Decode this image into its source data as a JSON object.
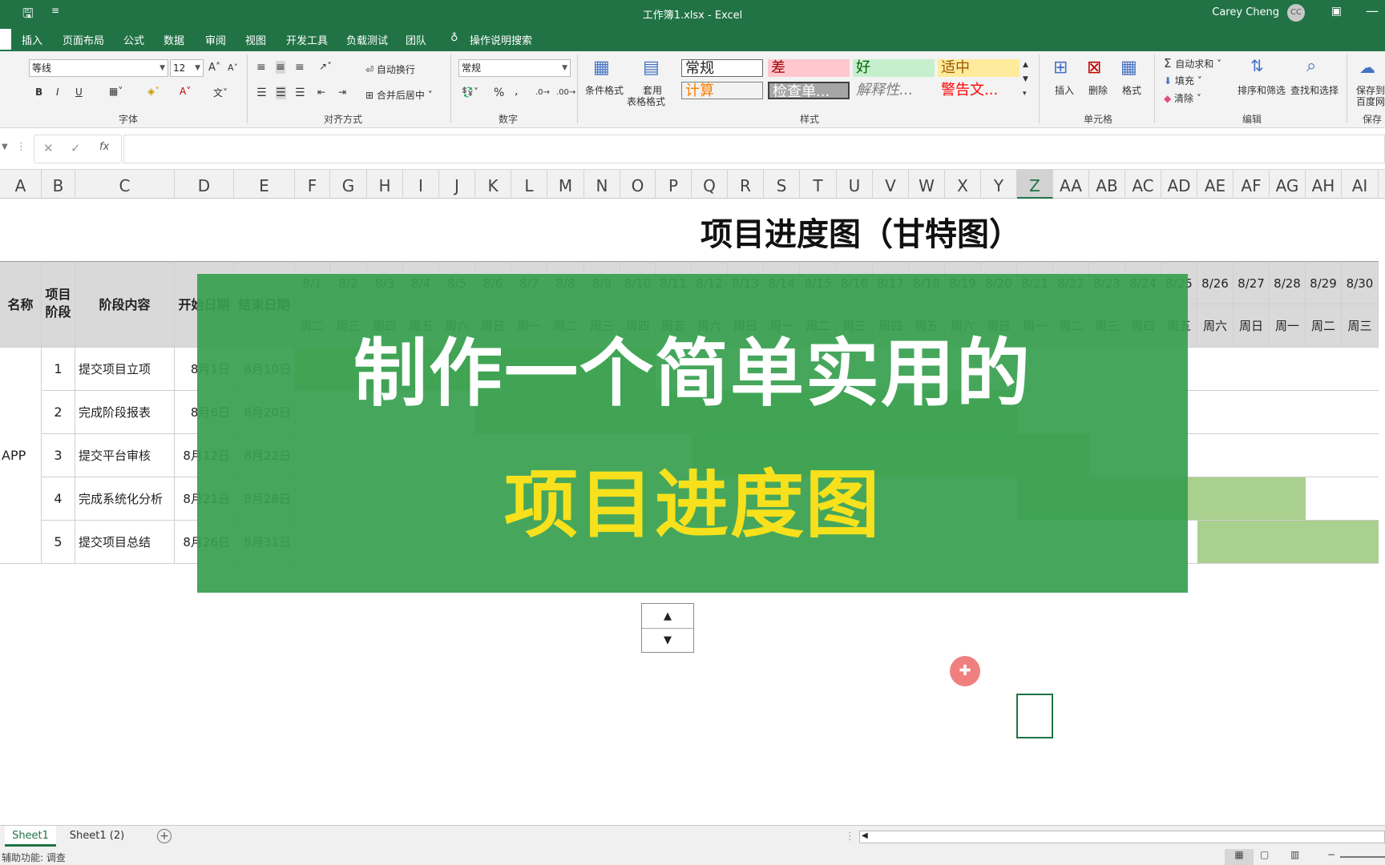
{
  "titlebar": {
    "title": "工作簿1.xlsx  -  Excel",
    "user": "Carey Cheng",
    "avatar": "CC"
  },
  "menu": [
    "插入",
    "页面布局",
    "公式",
    "数据",
    "审阅",
    "视图",
    "开发工具",
    "负载测试",
    "团队",
    "操作说明搜索"
  ],
  "ribbon": {
    "font_name": "等线",
    "font_size": "12",
    "wrap_text": "自动换行",
    "merge_center": "合并后居中",
    "number_format": "常规",
    "percent": "%",
    "comma": ",",
    "conditional_format": "条件格式",
    "table_format_1": "套用",
    "table_format_2": "表格格式",
    "styles": [
      "常规",
      "差",
      "好",
      "适中",
      "计算",
      "检查单...",
      "解释性...",
      "警告文..."
    ],
    "insert": "插入",
    "delete": "删除",
    "format": "格式",
    "autosum": "自动求和",
    "fill": "填充",
    "clear": "清除",
    "sort_filter": "排序和筛选",
    "find_select": "查找和选择",
    "save_baidu_1": "保存到",
    "save_baidu_2": "百度网",
    "group_font": "字体",
    "group_align": "对齐方式",
    "group_number": "数字",
    "group_styles": "样式",
    "group_cells": "单元格",
    "group_edit": "编辑",
    "group_save": "保存",
    "bold": "B",
    "italic": "I",
    "underline": "U"
  },
  "formula": {
    "fx": "fx",
    "cancel": "✕",
    "confirm": "✓",
    "value": ""
  },
  "columns": [
    "A",
    "B",
    "C",
    "D",
    "E",
    "F",
    "G",
    "H",
    "I",
    "J",
    "K",
    "L",
    "M",
    "N",
    "O",
    "P",
    "Q",
    "R",
    "S",
    "T",
    "U",
    "V",
    "W",
    "X",
    "Y",
    "Z",
    "AA",
    "AB",
    "AC",
    "AD",
    "AE",
    "AF",
    "AG",
    "AH",
    "AI"
  ],
  "sheet": {
    "title": "项目进度图（甘特图）",
    "headers": {
      "name": "名称",
      "stage": "项目阶段",
      "content": "阶段内容",
      "start": "开始日期",
      "end": "结束日期"
    },
    "project_name": "APP",
    "dates": [
      "8/1",
      "8/2",
      "8/3",
      "8/4",
      "8/5",
      "8/6",
      "8/7",
      "8/8",
      "8/9",
      "8/10",
      "8/11",
      "8/12",
      "8/13",
      "8/14",
      "8/15",
      "8/16",
      "8/17",
      "8/18",
      "8/19",
      "8/20",
      "8/21",
      "8/22",
      "8/23",
      "8/24",
      "8/25",
      "8/26",
      "8/27",
      "8/28",
      "8/29",
      "8/30"
    ],
    "weekdays": [
      "周二",
      "周三",
      "周四",
      "周五",
      "周六",
      "周日",
      "周一",
      "周二",
      "周三",
      "周四",
      "周五",
      "周六",
      "周日",
      "周一",
      "周二",
      "周三",
      "周四",
      "周五",
      "周六",
      "周日",
      "周一",
      "周二",
      "周三",
      "周四",
      "周五",
      "周六",
      "周日",
      "周一",
      "周二",
      "周三"
    ],
    "rows": [
      {
        "no": "1",
        "content": "提交项目立项",
        "start": "8月1日",
        "end": "8月10日"
      },
      {
        "no": "2",
        "content": "完成阶段报表",
        "start": "8月6日",
        "end": "8月20日"
      },
      {
        "no": "3",
        "content": "提交平台审核",
        "start": "8月12日",
        "end": "8月22日"
      },
      {
        "no": "4",
        "content": "完成系统化分析",
        "start": "8月21日",
        "end": "8月28日"
      },
      {
        "no": "5",
        "content": "提交项目总结",
        "start": "8月26日",
        "end": "8月31日"
      }
    ]
  },
  "banner": {
    "line1": "制作一个简单实用的",
    "line2": "项目进度图"
  },
  "tabs": [
    "Sheet1",
    "Sheet1 (2)"
  ],
  "status": {
    "text": "辅助功能: 调查"
  },
  "colors": {
    "excel_green": "#217346",
    "gantt_bar": "#a9d08e",
    "banner_bg": "#38a050",
    "banner_highlight": "#f7e11c"
  }
}
